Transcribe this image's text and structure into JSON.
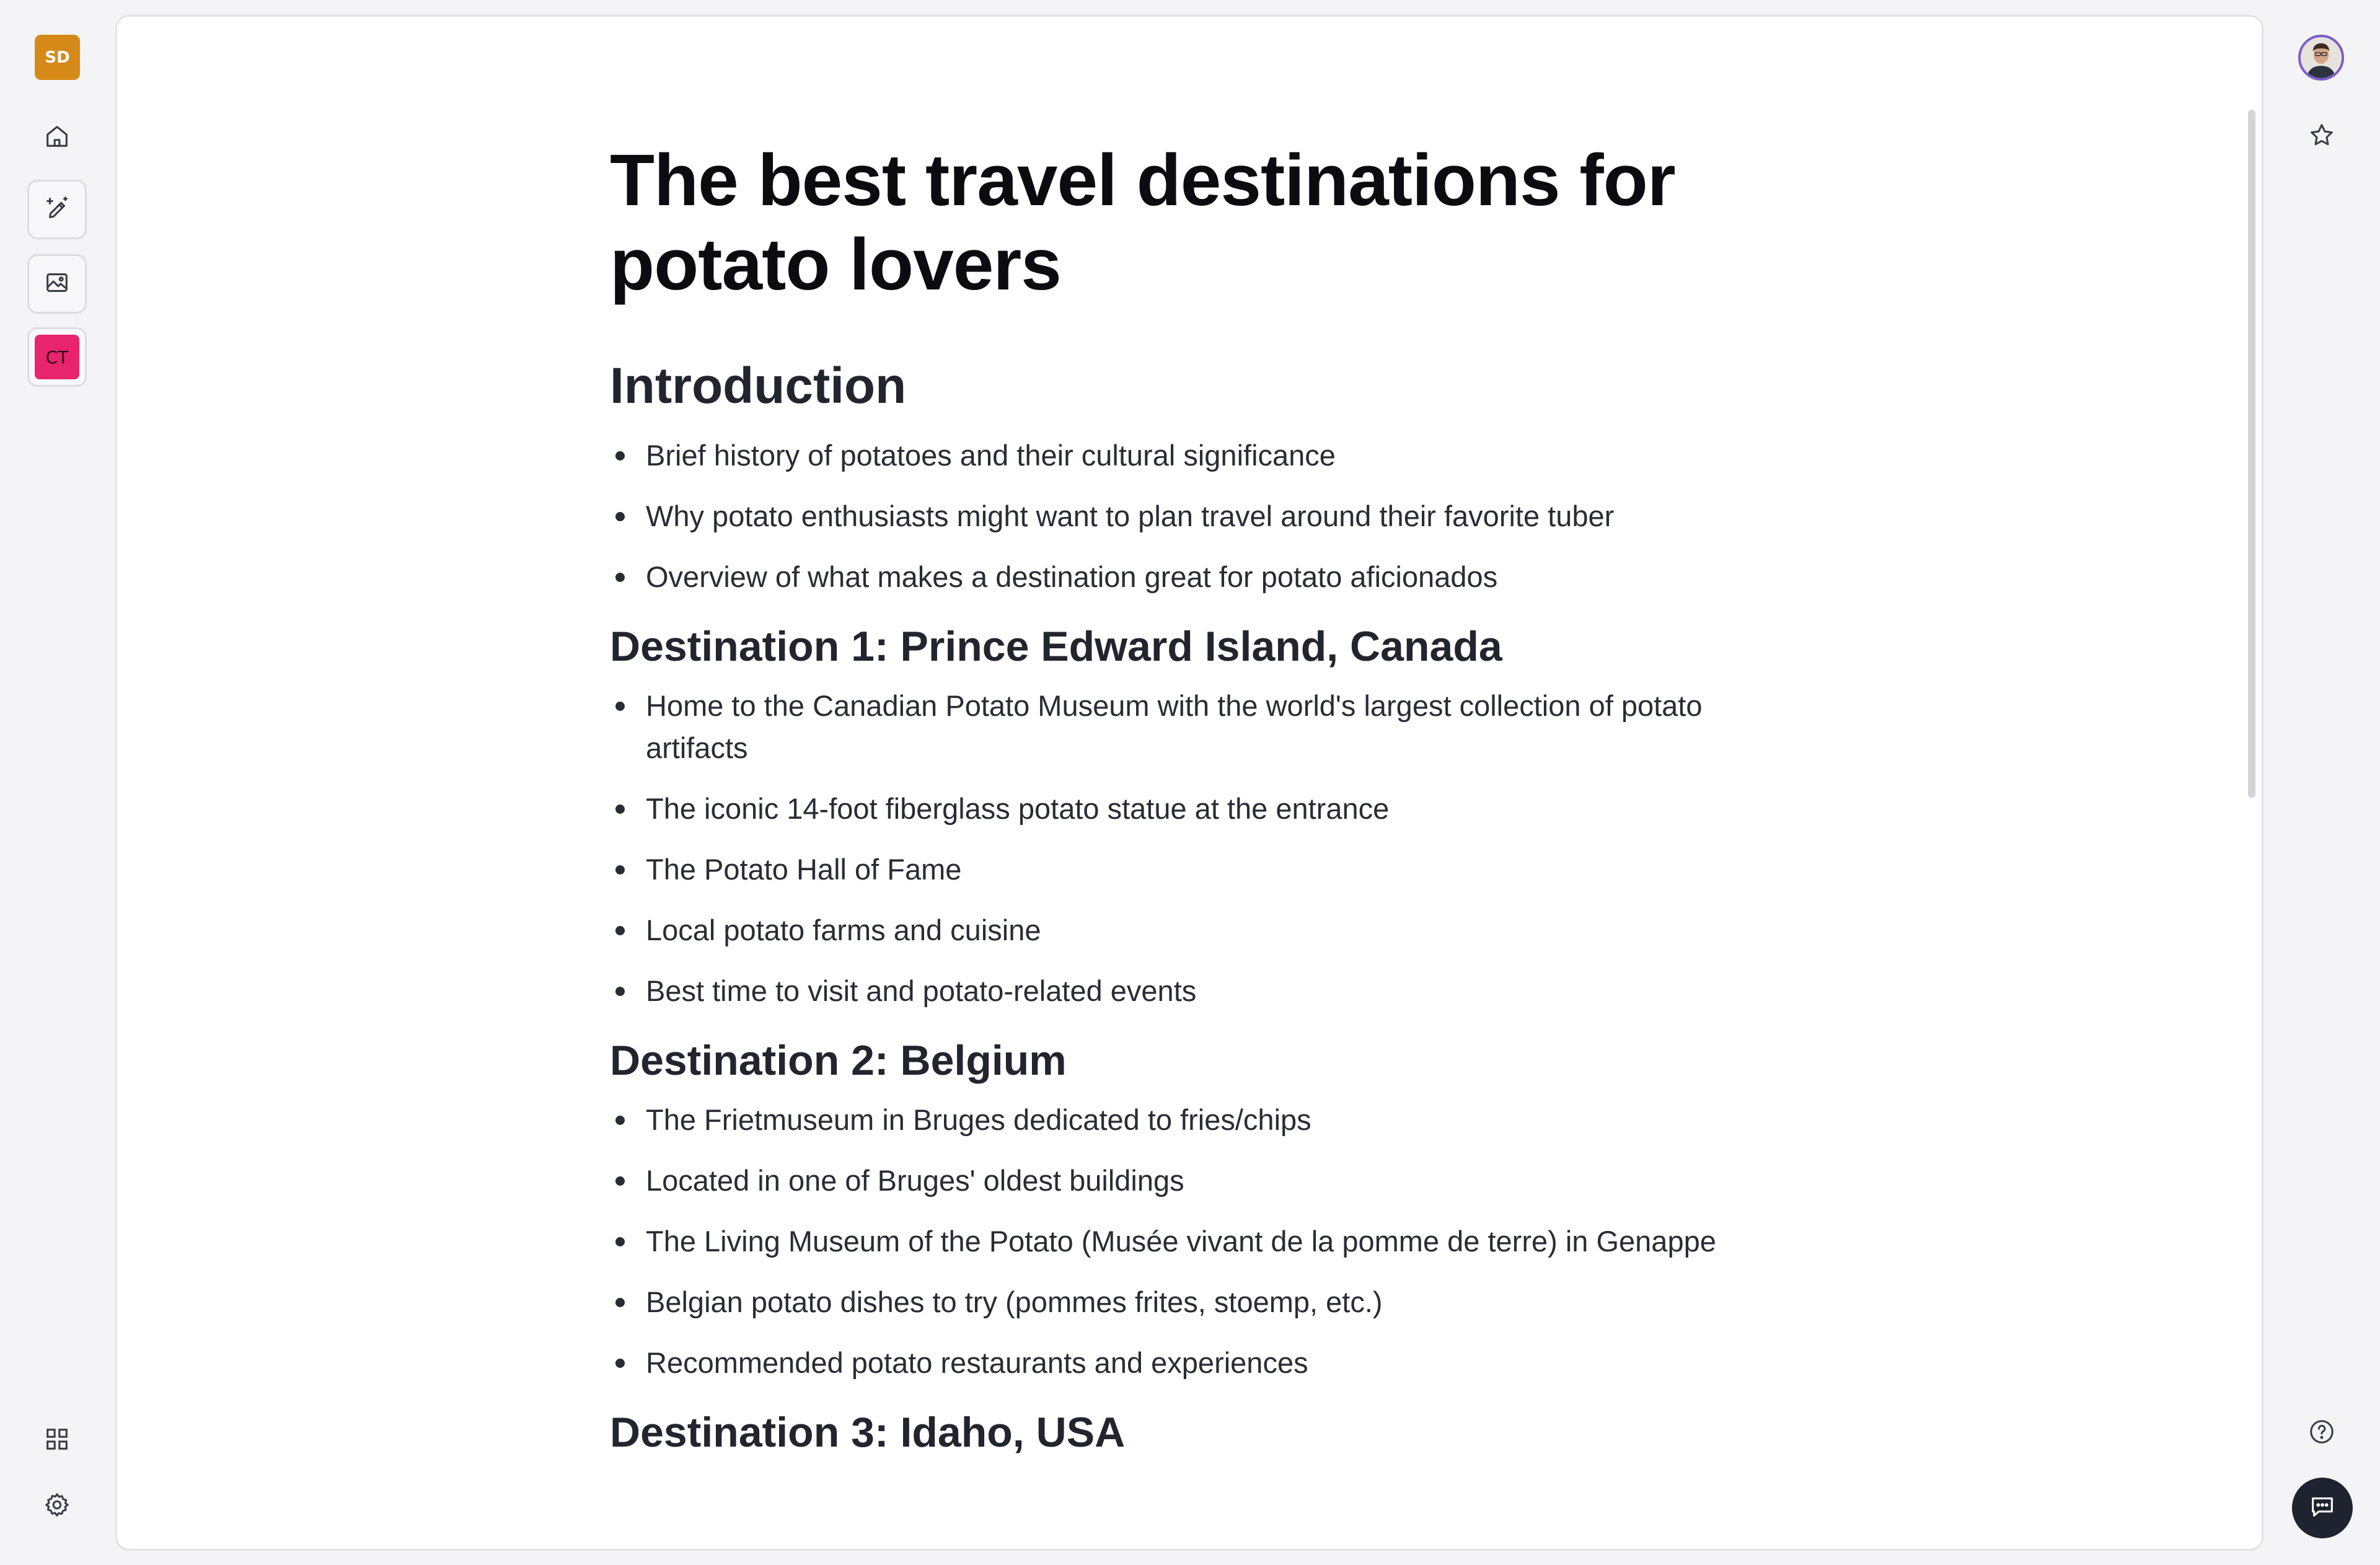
{
  "left_rail": {
    "workspace_initials": "SD",
    "workspace_color": "#d58a17",
    "icons": [
      "home-icon",
      "magic-wand-pen-icon",
      "image-icon",
      "grid-icon",
      "gear-icon"
    ],
    "ct_initials": "CT",
    "ct_color": "#e8246d"
  },
  "document": {
    "title": "The best travel destinations for potato lovers",
    "sections": [
      {
        "heading": "Introduction",
        "items": [
          "Brief history of potatoes and their cultural significance",
          "Why potato enthusiasts might want to plan travel around their favorite tuber",
          "Overview of what makes a destination great for potato aficionados"
        ]
      },
      {
        "heading": "Destination 1: Prince Edward Island, Canada",
        "items": [
          "Home to the Canadian Potato Museum with the world's largest collection of potato artifacts",
          "The iconic 14-foot fiberglass potato statue at the entrance",
          "The Potato Hall of Fame",
          "Local potato farms and cuisine",
          "Best time to visit and potato-related events"
        ]
      },
      {
        "heading": "Destination 2: Belgium",
        "items": [
          "The Frietmuseum in Bruges dedicated to fries/chips",
          "Located in one of Bruges' oldest buildings",
          "The Living Museum of the Potato (Musée vivant de la pomme de terre) in Genappe",
          "Belgian potato dishes to try (pommes frites, stoemp, etc.)",
          "Recommended potato restaurants and experiences"
        ]
      },
      {
        "heading": "Destination 3: Idaho, USA",
        "items": []
      }
    ]
  },
  "right_rail": {
    "icons": [
      "user-avatar",
      "star-icon",
      "help-icon",
      "chat-icon"
    ]
  }
}
